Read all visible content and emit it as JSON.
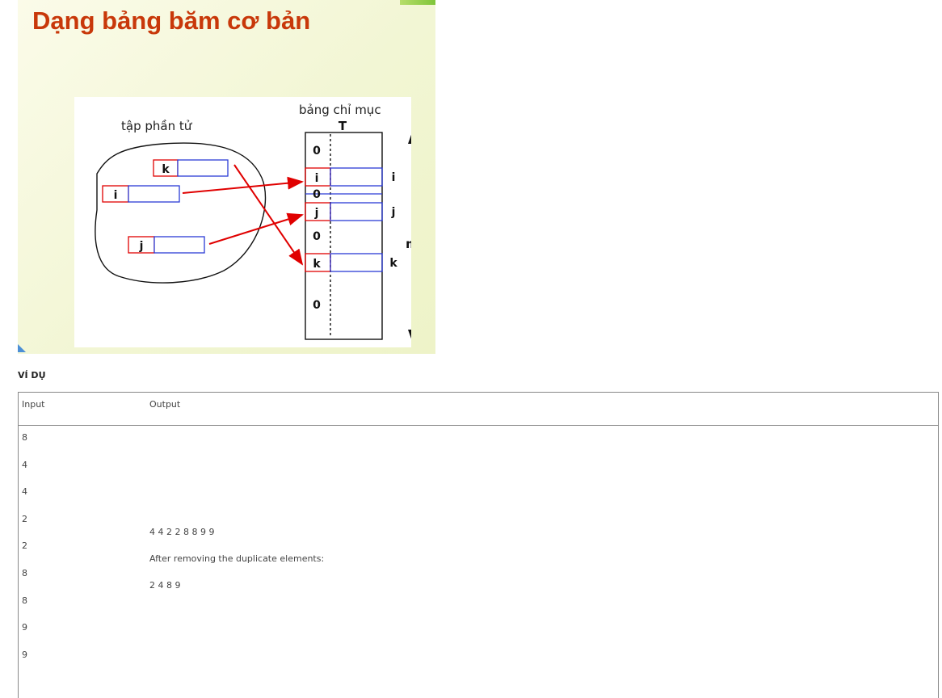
{
  "slide": {
    "title": "Dạng bảng băm cơ bản",
    "diagram": {
      "set_label": "tập phần tử",
      "table_label": "bảng chỉ mục",
      "table_name": "T",
      "size_label": "m",
      "element_keys": [
        "k",
        "i",
        "j"
      ],
      "slot_values": [
        "0",
        "i",
        "0",
        "j",
        "0",
        "k",
        "0"
      ],
      "index_labels": [
        "i",
        "j",
        "k"
      ]
    }
  },
  "example": {
    "heading": "VÍ DỤ",
    "columns": {
      "input": "Input",
      "output": "Output"
    },
    "input_values": [
      "8",
      "4",
      "4",
      "2",
      "2",
      "8",
      "8",
      "9",
      "9"
    ],
    "output_lines": [
      "4 4 2 2 8 8 9 9",
      "After removing the duplicate elements:",
      "2 4 8 9"
    ]
  }
}
